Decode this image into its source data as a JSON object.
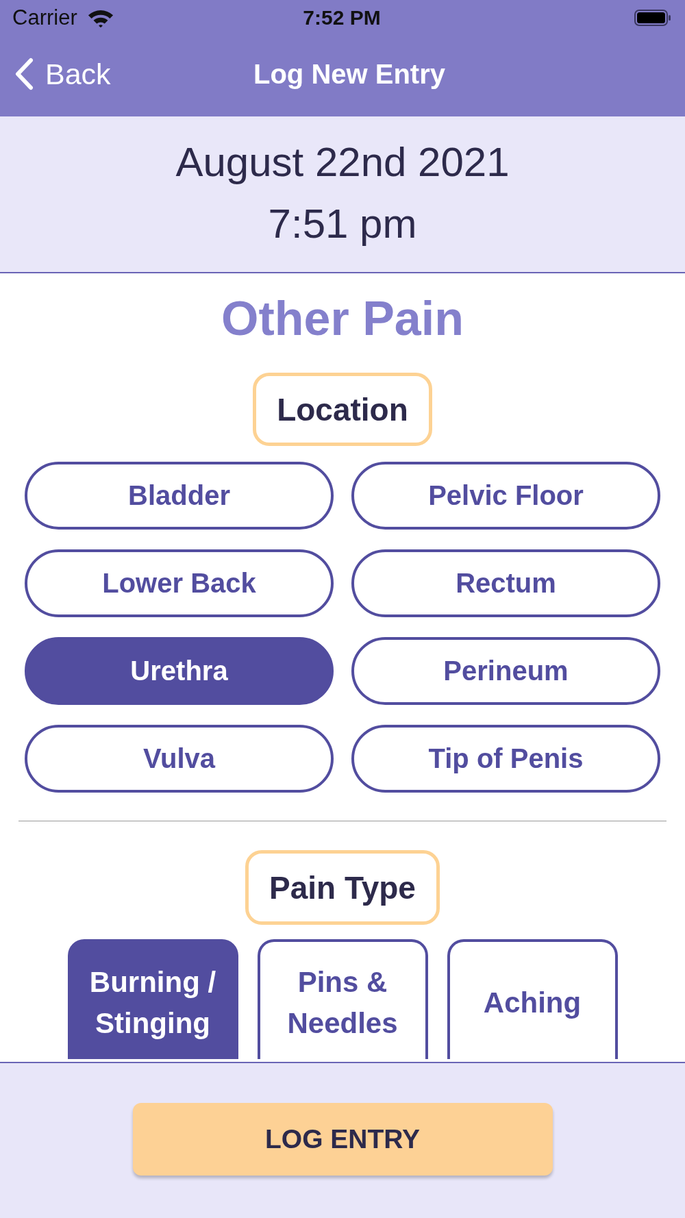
{
  "status_bar": {
    "carrier": "Carrier",
    "time": "7:52 PM"
  },
  "nav_bar": {
    "back_label": "Back",
    "title": "Log New Entry"
  },
  "entry_header": {
    "date": "August 22nd 2021",
    "time": "7:51 pm"
  },
  "section_title": "Other Pain",
  "location": {
    "label": "Location",
    "options": [
      {
        "label": "Bladder",
        "selected": false
      },
      {
        "label": "Pelvic Floor",
        "selected": false
      },
      {
        "label": "Lower Back",
        "selected": false
      },
      {
        "label": "Rectum",
        "selected": false
      },
      {
        "label": "Urethra",
        "selected": true
      },
      {
        "label": "Perineum",
        "selected": false
      },
      {
        "label": "Vulva",
        "selected": false
      },
      {
        "label": "Tip of Penis",
        "selected": false
      }
    ]
  },
  "pain_type": {
    "label": "Pain Type",
    "options": [
      {
        "label": "Burning / Stinging",
        "selected": true
      },
      {
        "label": "Pins & Needles",
        "selected": false
      },
      {
        "label": "Aching",
        "selected": false
      }
    ]
  },
  "log_button": "LOG ENTRY"
}
